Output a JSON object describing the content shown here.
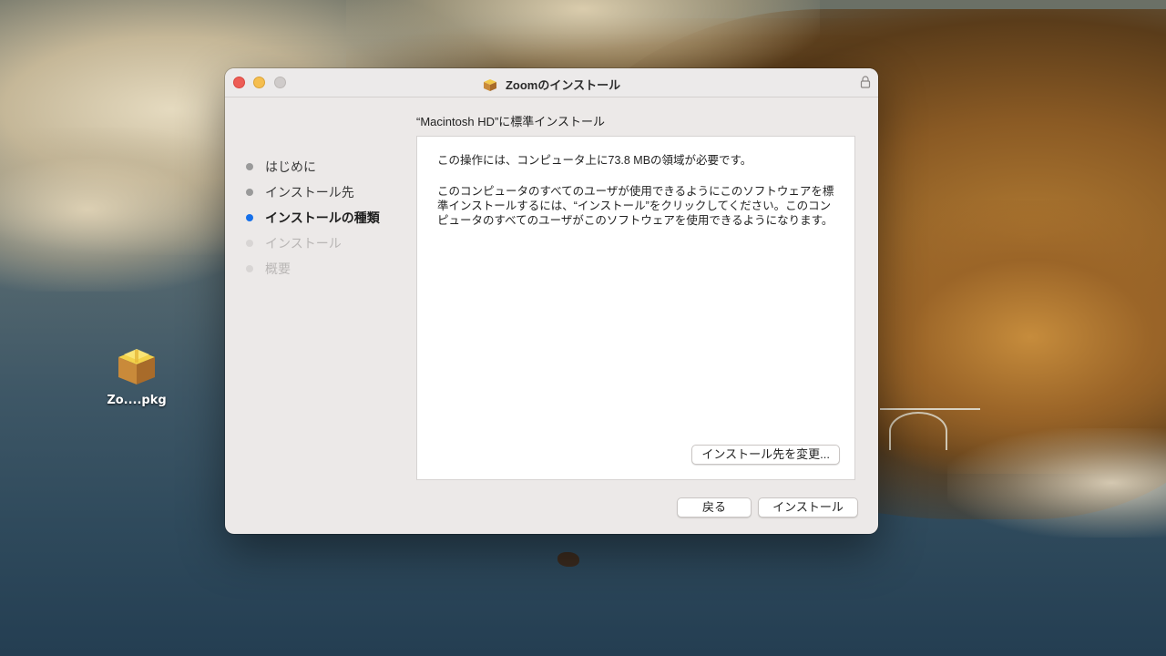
{
  "desktop": {
    "icon_label": "Zo....pkg"
  },
  "window": {
    "title": "Zoomのインストール",
    "header": "“Macintosh HD”に標準インストール",
    "steps": [
      {
        "label": "はじめに",
        "state": "done"
      },
      {
        "label": "インストール先",
        "state": "done"
      },
      {
        "label": "インストールの種類",
        "state": "current"
      },
      {
        "label": "インストール",
        "state": "pending"
      },
      {
        "label": "概要",
        "state": "pending"
      }
    ],
    "content": {
      "paragraph1": "この操作には、コンピュータ上に73.8 MBの領域が必要です。",
      "paragraph2": "このコンピュータのすべてのユーザが使用できるようにこのソフトウェアを標準インストールするには、“インストール”をクリックしてください。このコンピュータのすべてのユーザがこのソフトウェアを使用できるようになります。"
    },
    "buttons": {
      "change_location": "インストール先を変更...",
      "back": "戻る",
      "install": "インストール"
    }
  },
  "icons": {
    "window_controls": [
      "close-icon",
      "minimize-icon",
      "zoom-icon"
    ],
    "title_icon": "package-icon",
    "lock_icon": "lock-icon",
    "desktop_icon": "package-icon"
  },
  "colors": {
    "accent": "#1670ea",
    "close": "#ed5d56",
    "minimize": "#f5be4f",
    "zoom_inactive": "#cfcbca"
  }
}
